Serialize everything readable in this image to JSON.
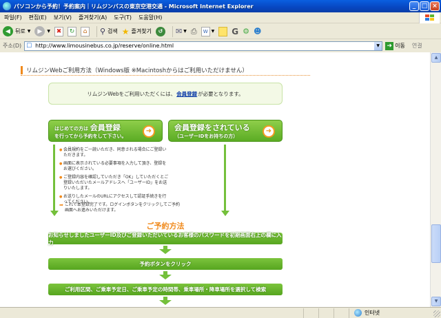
{
  "window": {
    "title": "パソコンから予約！予約案内｜リムジンバスの東京空港交通 - Microsoft Internet Explorer",
    "minimize": "_",
    "maximize": "□",
    "close": "×"
  },
  "menu": [
    "파일(F)",
    "편집(E)",
    "보기(V)",
    "즐겨찾기(A)",
    "도구(T)",
    "도움말(H)"
  ],
  "toolbar": {
    "back": "뒤로",
    "search": "검색",
    "favorites": "즐겨찾기"
  },
  "address": {
    "label": "주소(D)",
    "url": "http://www.limousinebus.co.jp/reserve/online.html",
    "go": "이동",
    "links": "연결"
  },
  "page": {
    "heading": "リムジンWebご利用方法（Windows版 ※Macintoshからはご利用いただけません）",
    "notice_before": "リムジンWebをご利用いただくには、",
    "notice_link": "会員登録",
    "notice_after": "が必要となります。",
    "btn_new_big": "会員登録",
    "btn_new_prefix": "はじめての方は",
    "btn_new_sub": "を行ってから予約をして下さい。",
    "btn_member_big": "会員登録をされている",
    "btn_member_sub": "（ユーザーIDをお持ちの方）",
    "steps": [
      "会員規約をご一読いただき、同意される場合にご登録いただきます。",
      "画面に表示されている必要事項を入力して頂き、登録をお選びください。",
      "ご登録内容を確認していただき「OK」していただくとご登録いただいたメールアドレスへ「ユーザーID」をお送りいたします。",
      "お送りしたメールのURLにアクセスして認証手続きを行ってください。"
    ],
    "final_step": "これで本登録完了です。ログインボタンをクリックしてご予約画面へお進みいただけます。",
    "procedure_title": "ご予約方法",
    "band1": "お知らせしましたユーザーID及びご登録いただいているお客様のパスワードを初期画面右上の欄に入力",
    "band2": "予約ボタンをクリック",
    "band3": "ご利用区間、ご乗車予定日、ご乗車予定の時間帯、乗車場所・降車場所を選択して検索"
  },
  "status": {
    "zone": "인터넷"
  }
}
